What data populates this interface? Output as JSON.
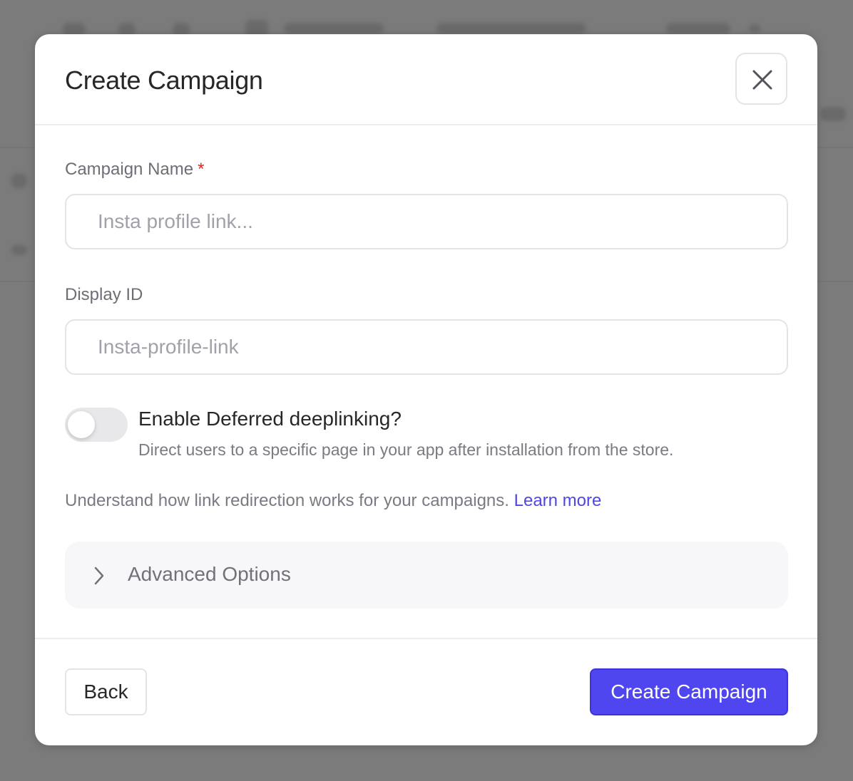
{
  "modal": {
    "title": "Create Campaign",
    "close_icon": "close-icon"
  },
  "form": {
    "campaign_name": {
      "label": "Campaign Name",
      "required_marker": "*",
      "value": "",
      "placeholder": "Insta profile link..."
    },
    "display_id": {
      "label": "Display ID",
      "value": "",
      "placeholder": "Insta-profile-link"
    },
    "deferred_deeplinking": {
      "enabled": false,
      "title": "Enable Deferred deeplinking?",
      "description": "Direct users to a specific page in your app after installation from the store."
    },
    "help": {
      "text": "Understand how link redirection works for your campaigns.",
      "link_label": "Learn more"
    },
    "advanced": {
      "label": "Advanced Options",
      "icon": "chevron-right-icon",
      "expanded": false
    }
  },
  "footer": {
    "back_label": "Back",
    "submit_label": "Create Campaign"
  },
  "colors": {
    "accent": "#4f46f0",
    "link": "#4f46e5",
    "required": "#dc2626",
    "overlay": "#7b7b7c"
  }
}
